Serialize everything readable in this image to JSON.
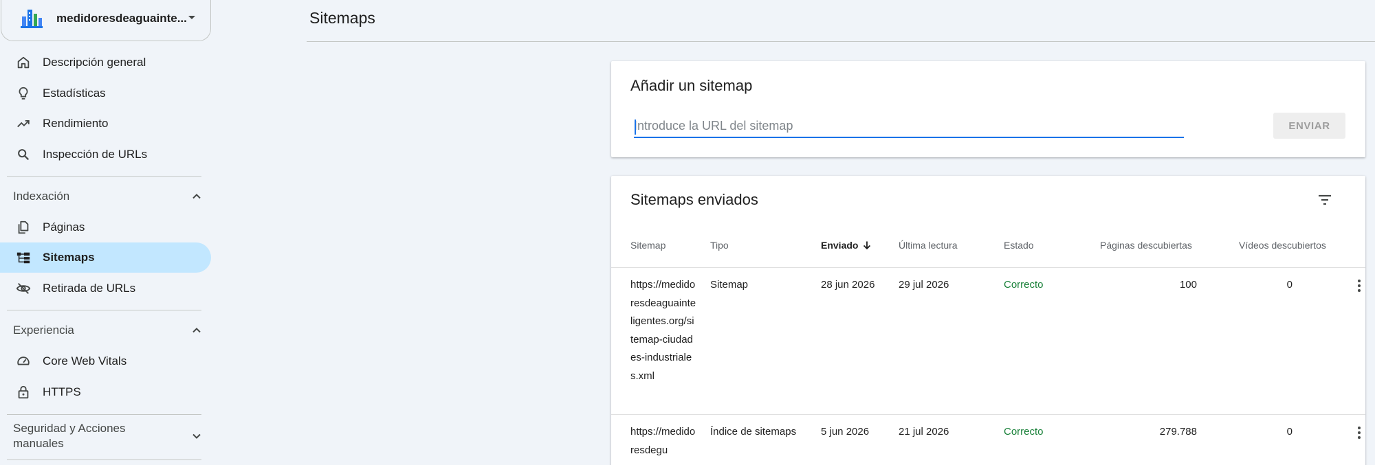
{
  "property": {
    "name": "medidoresdeaguainte...",
    "logo_colors": [
      "#1a73e8",
      "#34a853",
      "#4285f4"
    ]
  },
  "nav": {
    "top_items": [
      {
        "label": "Descripción general",
        "icon": "home-icon"
      },
      {
        "label": "Estadísticas",
        "icon": "lightbulb-icon"
      },
      {
        "label": "Rendimiento",
        "icon": "trending-up-icon"
      },
      {
        "label": "Inspección de URLs",
        "icon": "search-icon"
      }
    ],
    "sections": [
      {
        "label": "Indexación",
        "expanded": true,
        "items": [
          {
            "label": "Páginas",
            "icon": "pages-icon"
          },
          {
            "label": "Sitemaps",
            "icon": "sitemap-icon",
            "active": true
          },
          {
            "label": "Retirada de URLs",
            "icon": "visibility-off-icon"
          }
        ]
      },
      {
        "label": "Experiencia",
        "expanded": true,
        "items": [
          {
            "label": "Core Web Vitals",
            "icon": "speed-icon"
          },
          {
            "label": "HTTPS",
            "icon": "lock-icon"
          }
        ]
      },
      {
        "label": "Seguridad y Acciones manuales",
        "expanded": false,
        "items": []
      }
    ]
  },
  "header": {
    "title": "Sitemaps"
  },
  "add_sitemap": {
    "title": "Añadir un sitemap",
    "placeholder": "Introduce la URL del sitemap",
    "submit_label": "ENVIAR"
  },
  "submitted": {
    "title": "Sitemaps enviados",
    "columns": [
      "Sitemap",
      "Tipo",
      "Enviado",
      "Última lectura",
      "Estado",
      "Páginas descubiertas",
      "Vídeos descubiertos"
    ],
    "sorted_column": "Enviado",
    "rows": [
      {
        "sitemap": "https://medidoresdeaguainteligentes.org/sitemap-ciudades-industriales.xml",
        "type": "Sitemap",
        "submitted": "28 jun 2026",
        "last_read": "29 jul 2026",
        "status": "Correcto",
        "pages": "100",
        "videos": "0"
      },
      {
        "sitemap": "https://medidoresdegu",
        "type": "Índice de sitemaps",
        "submitted": "5 jun 2026",
        "last_read": "21 jul 2026",
        "status": "Correcto",
        "pages": "279.788",
        "videos": "0"
      }
    ]
  },
  "colors": {
    "background": "#f0f4f9",
    "active_nav": "#c2e7ff",
    "accent": "#1a73e8",
    "status_ok": "#188038"
  }
}
